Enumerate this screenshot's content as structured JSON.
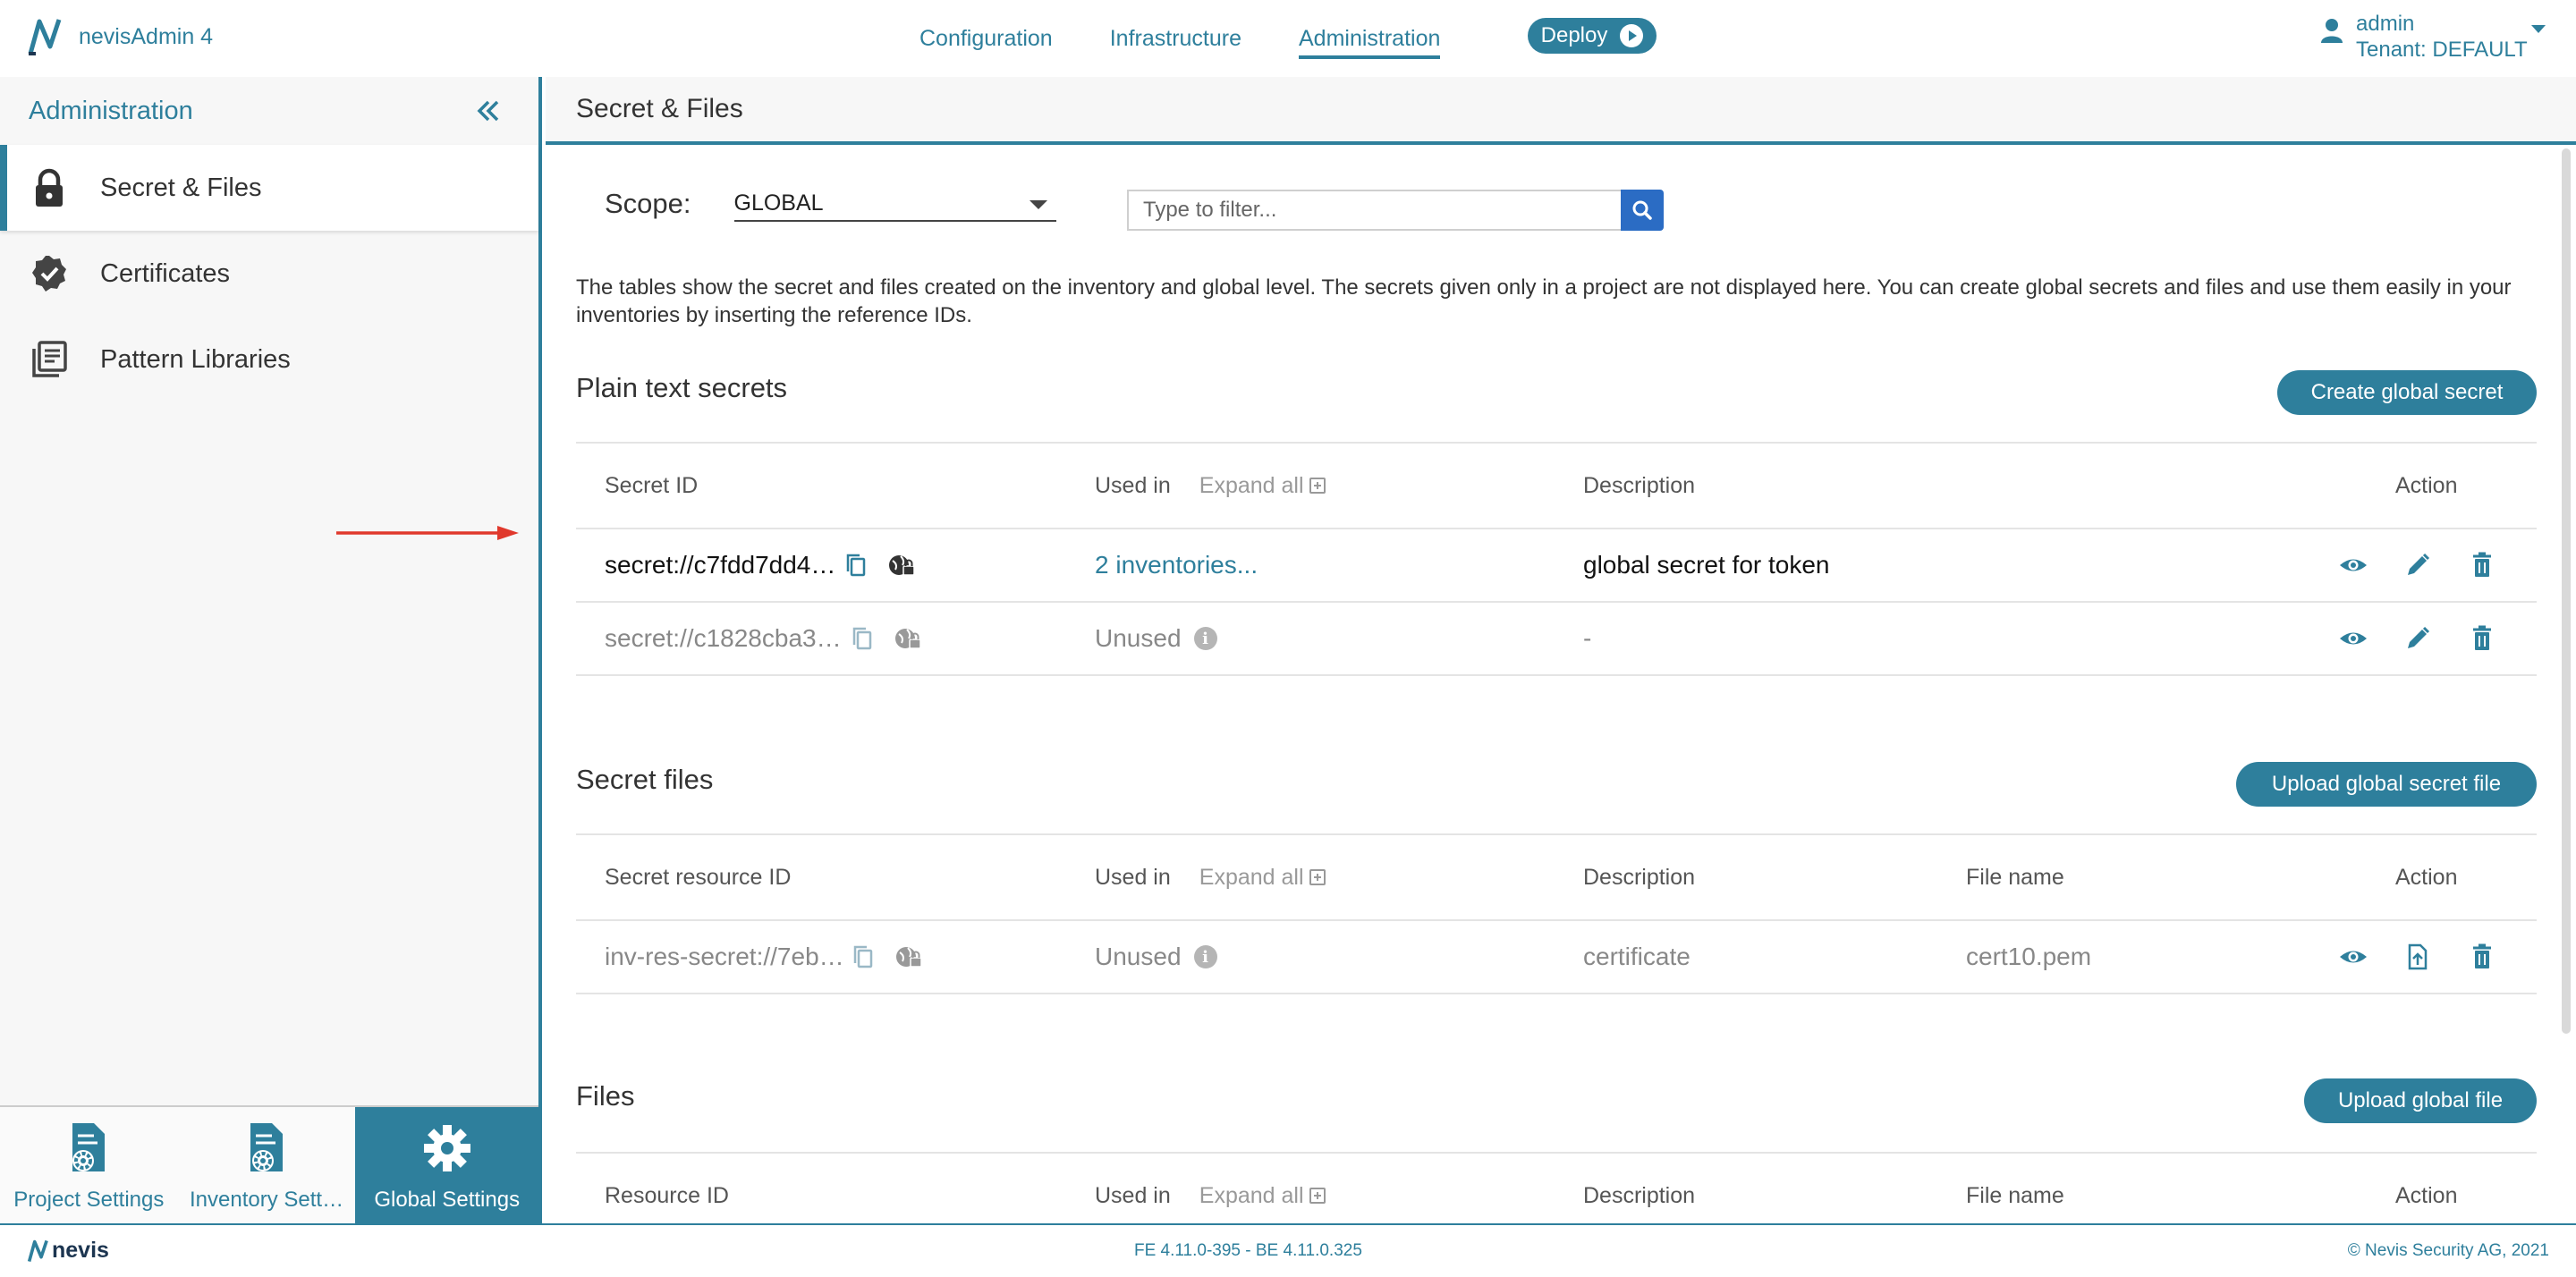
{
  "app": {
    "name": "nevisAdmin 4"
  },
  "nav": {
    "items": [
      "Configuration",
      "Infrastructure",
      "Administration"
    ],
    "deploy_label": "Deploy"
  },
  "user": {
    "name": "admin",
    "tenant": "Tenant: DEFAULT"
  },
  "sidebar": {
    "title": "Administration",
    "items": [
      {
        "label": "Secret & Files",
        "icon": "lock-icon"
      },
      {
        "label": "Certificates",
        "icon": "certificate-badge-icon"
      },
      {
        "label": "Pattern Libraries",
        "icon": "library-icon"
      }
    ],
    "bottom_tabs": [
      "Project Settings",
      "Inventory Sett…",
      "Global Settings"
    ]
  },
  "main": {
    "title": "Secret & Files",
    "scope_label": "Scope:",
    "scope_value": "GLOBAL",
    "filter_placeholder": "Type to filter...",
    "info": "The tables show the secret and files created on the inventory and global level. The secrets given only in a project are not displayed here. You can create global secrets and files and use them easily in your inventories by inserting the reference IDs."
  },
  "plain_secrets": {
    "title": "Plain text secrets",
    "create_label": "Create global secret",
    "columns": [
      "Secret ID",
      "Used in",
      "Expand all",
      "Description",
      "Action"
    ],
    "rows": [
      {
        "id": "secret://c7fdd7dd4…",
        "used": "2 inventories...",
        "description": "global secret for token"
      },
      {
        "id": "secret://c1828cba3…",
        "used": "Unused",
        "description": "-"
      }
    ]
  },
  "secret_files": {
    "title": "Secret files",
    "upload_label": "Upload global secret file",
    "columns": [
      "Secret resource ID",
      "Used in",
      "Expand all",
      "Description",
      "File name",
      "Action"
    ],
    "rows": [
      {
        "id": "inv-res-secret://7eb…",
        "used": "Unused",
        "description": "certificate",
        "file": "cert10.pem"
      }
    ]
  },
  "files": {
    "title": "Files",
    "upload_label": "Upload global file",
    "columns": [
      "Resource ID",
      "Used in",
      "Expand all",
      "Description",
      "File name",
      "Action"
    ]
  },
  "footer": {
    "logo": "nevis",
    "version": "FE 4.11.0-395 - BE 4.11.0.325",
    "copyright": "© Nevis Security AG, 2021"
  },
  "colors": {
    "accent": "#2e7f9c",
    "search_button": "#2b6cc4",
    "annotation_arrow": "#e0382c"
  }
}
